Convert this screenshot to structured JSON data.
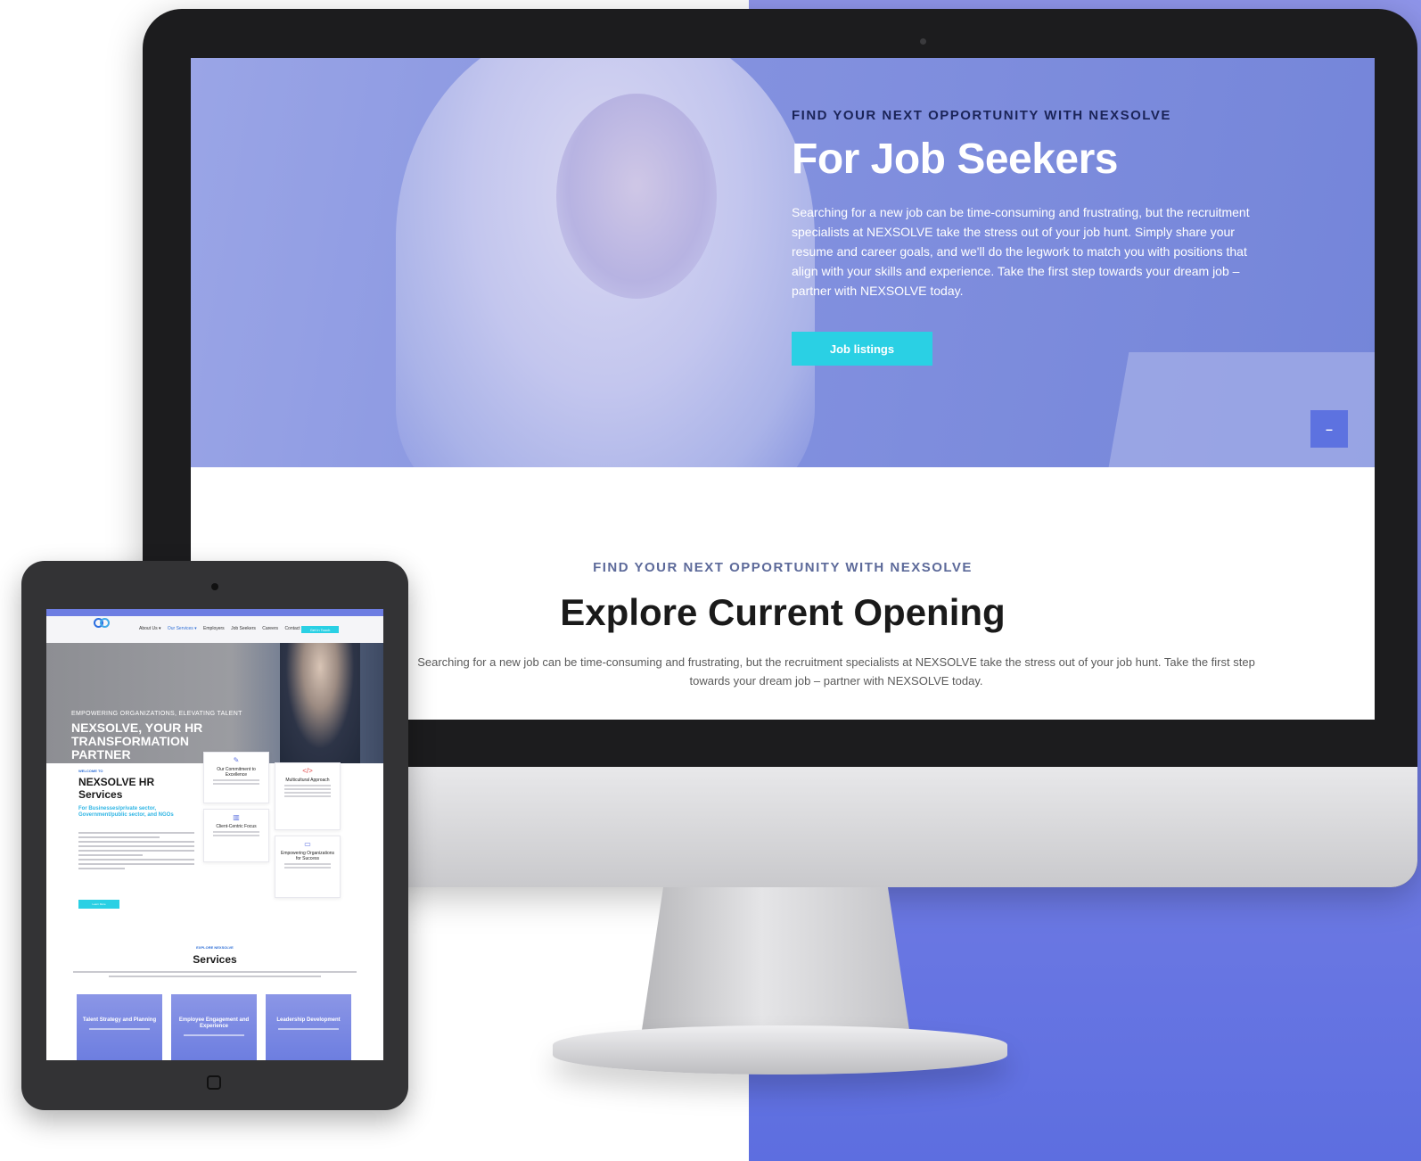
{
  "desktop": {
    "hero": {
      "eyebrow": "FIND YOUR NEXT OPPORTUNITY WITH NEXSOLVE",
      "title": "For Job Seekers",
      "text": "Searching for a new job can be time-consuming and frustrating, but the recruitment specialists at NEXSOLVE take the stress out of your job hunt. Simply share your resume and career goals, and we'll do the legwork to match you with positions that align with your skills and experience. Take the first step towards your dream job – partner with NEXSOLVE today.",
      "button_label": "Job listings",
      "scroll_button_label": "–"
    },
    "explore": {
      "eyebrow": "FIND YOUR NEXT OPPORTUNITY WITH NEXSOLVE",
      "title": "Explore Current Opening",
      "text": "Searching for a new job can be time-consuming and frustrating, but the recruitment specialists at NEXSOLVE take the stress out of your job hunt. Take the first step towards your dream job – partner with NEXSOLVE today."
    }
  },
  "tablet": {
    "nav": {
      "items": [
        {
          "label": "About Us ▾",
          "active": false
        },
        {
          "label": "Our Services ▾",
          "active": true
        },
        {
          "label": "Employers",
          "active": false
        },
        {
          "label": "Job Seekers",
          "active": false
        },
        {
          "label": "Careers",
          "active": false
        },
        {
          "label": "Contact ▾",
          "active": false
        }
      ],
      "cta_label": "Get In Touch"
    },
    "hero": {
      "eyebrow": "EMPOWERING ORGANIZATIONS, ELEVATING TALENT",
      "title": "NEXSOLVE, YOUR HR TRANSFORMATION PARTNER"
    },
    "welcome": {
      "eyebrow": "WELCOME TO",
      "title": "NEXSOLVE HR Services",
      "subtitle": "For Businesses/private sector, Government/public sector, and NGOs",
      "button_label": "Learn More"
    },
    "cards": [
      {
        "icon": "✎",
        "icon_name": "edit-icon",
        "title": "Our Commitment to Excellence"
      },
      {
        "icon": "▥",
        "icon_name": "bar-chart-icon",
        "title": "Client-Centric Focus"
      },
      {
        "icon": "</>",
        "icon_name": "code-icon",
        "title": "Multicultural Approach"
      },
      {
        "icon": "▭",
        "icon_name": "card-icon",
        "title": "Empowering Organizations for Success"
      }
    ],
    "services": {
      "eyebrow": "EXPLORE NEXSOLVE",
      "title": "Services",
      "items": [
        {
          "title": "Talent Strategy and Planning"
        },
        {
          "title": "Employee Engagement and Experience"
        },
        {
          "title": "Leadership Development"
        }
      ]
    }
  },
  "colors": {
    "accent": "#2ad0e4",
    "hero_overlay": "#8391df",
    "panel": "#7c84e6",
    "link_blue": "#2f6fd6"
  }
}
